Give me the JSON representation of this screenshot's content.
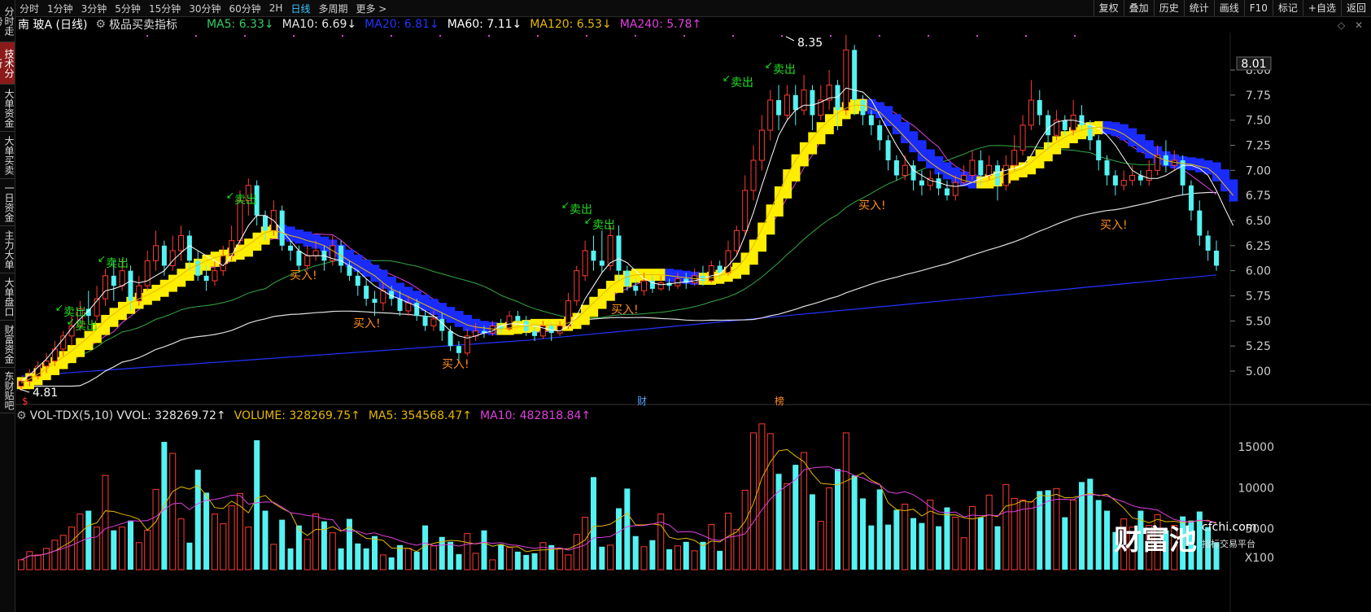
{
  "left_nav": [
    {
      "label": "分时走势",
      "active": false
    },
    {
      "label": "技术分析",
      "active": true
    },
    {
      "label": "大单资金",
      "active": false
    },
    {
      "label": "大单买卖",
      "active": false
    },
    {
      "label": "一日资金",
      "active": false
    },
    {
      "label": "主力大单",
      "active": false
    },
    {
      "label": "大单盘口",
      "active": false
    },
    {
      "label": "财富资金",
      "active": false
    },
    {
      "label": "东财贴吧",
      "active": false
    }
  ],
  "period_tabs": [
    "分时",
    "1分钟",
    "3分钟",
    "5分钟",
    "15分钟",
    "30分钟",
    "60分钟",
    "2H",
    "日线",
    "多周期",
    "更多 >"
  ],
  "active_period": "日线",
  "right_tools": [
    "复权",
    "叠加",
    "历史",
    "统计",
    "画线",
    "F10",
    "标记",
    "+自选",
    "返回"
  ],
  "legend": {
    "stock": "南 玻A (日线)",
    "indicator": "极品买卖指标",
    "ma": [
      {
        "text": "MA5: 6.33↓",
        "color": "#33cc66"
      },
      {
        "text": "MA10: 6.69↓",
        "color": "#e6e6e6"
      },
      {
        "text": "MA20: 6.81↓",
        "color": "#2233ff"
      },
      {
        "text": "MA60: 7.11↓",
        "color": "#ffffff"
      },
      {
        "text": "MA120: 6.53↓",
        "color": "#e6b800"
      },
      {
        "text": "MA240: 5.78↑",
        "color": "#e040e0"
      }
    ]
  },
  "vol_legend": {
    "title": "VOL-TDX(5,10)",
    "items": [
      {
        "text": "VVOL: 328269.72↑",
        "color": "#e6e6e6"
      },
      {
        "text": "VOLUME: 328269.75↑",
        "color": "#e6b800"
      },
      {
        "text": "MA5: 354568.47↑",
        "color": "#e6b800"
      },
      {
        "text": "MA10: 482818.84↑",
        "color": "#e040e0"
      }
    ]
  },
  "price_axis": {
    "labels": [
      "8.00",
      "7.75",
      "7.50",
      "7.25",
      "7.00",
      "6.75",
      "6.50",
      "6.25",
      "6.00",
      "5.75",
      "5.50",
      "5.25",
      "5.00"
    ],
    "current": "8.01"
  },
  "volume_axis": {
    "labels": [
      "15000",
      "10000",
      "5000"
    ],
    "unit": "X100"
  },
  "annotations": {
    "high": "8.35",
    "low": "4.81",
    "sell_label": "卖出",
    "buy_label": "买入!",
    "event_cai": "财",
    "event_bang": "榜",
    "event_s": "$"
  },
  "watermark": {
    "brand": "财富池",
    "site": "cfchi.com",
    "tagline": "指标交易平台"
  },
  "colors": {
    "up": "#ff3b30",
    "down": "#55f2f2",
    "ma5": "#ffffff",
    "ma10": "#e6b800",
    "ma20": "#e040e0",
    "ma60": "#33aa44",
    "ma120": "#dddddd",
    "ma240": "#2233ff",
    "band_up": "#ffee00",
    "band_down": "#1a2bff"
  },
  "chart_data": {
    "type": "candlestick",
    "ylim": [
      4.75,
      8.35
    ],
    "candles": [
      [
        4.85,
        4.9,
        4.8,
        4.92
      ],
      [
        4.9,
        4.95,
        4.85,
        5.02
      ],
      [
        4.95,
        5.05,
        4.92,
        5.1
      ],
      [
        5.05,
        5.1,
        4.98,
        5.18
      ],
      [
        5.1,
        5.22,
        5.05,
        5.3
      ],
      [
        5.22,
        5.35,
        5.15,
        5.4
      ],
      [
        5.35,
        5.45,
        5.25,
        5.55
      ],
      [
        5.45,
        5.62,
        5.4,
        5.7
      ],
      [
        5.62,
        5.55,
        5.48,
        5.8
      ],
      [
        5.55,
        5.72,
        5.5,
        5.85
      ],
      [
        5.72,
        5.95,
        5.65,
        6.02
      ],
      [
        5.95,
        5.85,
        5.7,
        6.1
      ],
      [
        5.85,
        6.0,
        5.8,
        6.12
      ],
      [
        6.0,
        5.7,
        5.6,
        6.05
      ],
      [
        5.7,
        5.85,
        5.65,
        5.95
      ],
      [
        5.85,
        6.1,
        5.8,
        6.2
      ],
      [
        6.1,
        6.25,
        6.0,
        6.4
      ],
      [
        6.25,
        6.05,
        5.95,
        6.3
      ],
      [
        6.05,
        6.2,
        6.0,
        6.35
      ],
      [
        6.2,
        6.35,
        6.1,
        6.45
      ],
      [
        6.35,
        6.1,
        6.0,
        6.4
      ],
      [
        6.1,
        5.95,
        5.9,
        6.2
      ],
      [
        5.95,
        5.9,
        5.8,
        6.05
      ],
      [
        5.9,
        6.0,
        5.85,
        6.1
      ],
      [
        6.0,
        6.15,
        5.95,
        6.25
      ],
      [
        6.15,
        6.3,
        6.1,
        6.45
      ],
      [
        6.3,
        6.7,
        6.25,
        6.8
      ],
      [
        6.7,
        6.85,
        6.55,
        6.92
      ],
      [
        6.85,
        6.55,
        6.45,
        6.9
      ],
      [
        6.55,
        6.4,
        6.3,
        6.6
      ],
      [
        6.4,
        6.6,
        6.35,
        6.7
      ],
      [
        6.6,
        6.25,
        6.2,
        6.65
      ],
      [
        6.25,
        6.2,
        6.1,
        6.3
      ],
      [
        6.2,
        6.05,
        6.0,
        6.25
      ],
      [
        6.05,
        6.15,
        6.0,
        6.25
      ],
      [
        6.15,
        6.2,
        6.1,
        6.3
      ],
      [
        6.2,
        6.1,
        6.0,
        6.25
      ],
      [
        6.1,
        6.25,
        6.05,
        6.35
      ],
      [
        6.25,
        6.05,
        5.98,
        6.3
      ],
      [
        6.05,
        5.95,
        5.9,
        6.1
      ],
      [
        5.95,
        5.85,
        5.75,
        6.0
      ],
      [
        5.85,
        5.72,
        5.65,
        5.92
      ],
      [
        5.72,
        5.68,
        5.55,
        5.8
      ],
      [
        5.68,
        5.8,
        5.6,
        5.88
      ],
      [
        5.8,
        5.72,
        5.65,
        5.85
      ],
      [
        5.72,
        5.6,
        5.55,
        5.8
      ],
      [
        5.6,
        5.68,
        5.55,
        5.75
      ],
      [
        5.68,
        5.55,
        5.5,
        5.72
      ],
      [
        5.55,
        5.45,
        5.4,
        5.6
      ],
      [
        5.45,
        5.52,
        5.4,
        5.6
      ],
      [
        5.52,
        5.4,
        5.3,
        5.58
      ],
      [
        5.4,
        5.25,
        5.2,
        5.45
      ],
      [
        5.25,
        5.18,
        5.1,
        5.3
      ],
      [
        5.18,
        5.35,
        5.15,
        5.42
      ],
      [
        5.35,
        5.4,
        5.3,
        5.48
      ],
      [
        5.4,
        5.38,
        5.33,
        5.45
      ],
      [
        5.38,
        5.45,
        5.35,
        5.5
      ],
      [
        5.45,
        5.42,
        5.38,
        5.52
      ],
      [
        5.42,
        5.55,
        5.4,
        5.6
      ],
      [
        5.55,
        5.5,
        5.45,
        5.6
      ],
      [
        5.5,
        5.4,
        5.35,
        5.55
      ],
      [
        5.4,
        5.35,
        5.3,
        5.45
      ],
      [
        5.35,
        5.45,
        5.32,
        5.5
      ],
      [
        5.45,
        5.38,
        5.3,
        5.48
      ],
      [
        5.38,
        5.45,
        5.35,
        5.5
      ],
      [
        5.45,
        5.7,
        5.42,
        5.78
      ],
      [
        5.7,
        6.0,
        5.65,
        6.05
      ],
      [
        5.95,
        6.2,
        5.9,
        6.3
      ],
      [
        6.2,
        6.1,
        6.0,
        6.35
      ],
      [
        6.1,
        6.05,
        5.98,
        6.4
      ],
      [
        6.05,
        6.35,
        6.0,
        6.45
      ],
      [
        6.35,
        6.0,
        5.9,
        6.45
      ],
      [
        6.0,
        5.85,
        5.8,
        6.05
      ],
      [
        5.85,
        5.8,
        5.75,
        5.92
      ],
      [
        5.8,
        5.9,
        5.75,
        5.98
      ],
      [
        5.9,
        5.82,
        5.78,
        5.95
      ],
      [
        5.82,
        5.88,
        5.8,
        5.95
      ],
      [
        5.88,
        5.85,
        5.8,
        5.92
      ],
      [
        5.85,
        5.92,
        5.82,
        5.98
      ],
      [
        5.92,
        5.88,
        5.82,
        5.98
      ],
      [
        5.88,
        5.95,
        5.85,
        6.02
      ],
      [
        5.95,
        5.9,
        5.85,
        6.05
      ],
      [
        5.9,
        6.05,
        5.88,
        6.1
      ],
      [
        6.05,
        5.98,
        5.92,
        6.1
      ],
      [
        5.98,
        6.2,
        5.95,
        6.3
      ],
      [
        6.2,
        6.4,
        6.15,
        6.45
      ],
      [
        6.4,
        6.8,
        6.35,
        6.95
      ],
      [
        6.8,
        7.1,
        6.7,
        7.25
      ],
      [
        7.1,
        7.4,
        7.0,
        7.55
      ],
      [
        7.4,
        7.7,
        7.3,
        7.8
      ],
      [
        7.7,
        7.55,
        7.4,
        7.85
      ],
      [
        7.55,
        7.75,
        7.5,
        7.85
      ],
      [
        7.75,
        7.6,
        7.45,
        7.85
      ],
      [
        7.6,
        7.8,
        7.55,
        7.95
      ],
      [
        7.8,
        7.55,
        7.4,
        7.85
      ],
      [
        7.55,
        7.7,
        7.5,
        7.85
      ],
      [
        7.7,
        7.85,
        7.6,
        8.0
      ],
      [
        7.85,
        7.6,
        7.4,
        7.9
      ],
      [
        7.6,
        8.2,
        7.55,
        8.35
      ],
      [
        8.2,
        7.7,
        7.55,
        8.25
      ],
      [
        7.7,
        7.55,
        7.45,
        7.75
      ],
      [
        7.55,
        7.45,
        7.35,
        7.6
      ],
      [
        7.45,
        7.3,
        7.2,
        7.5
      ],
      [
        7.3,
        7.1,
        7.0,
        7.35
      ],
      [
        7.1,
        6.95,
        6.9,
        7.15
      ],
      [
        6.95,
        7.05,
        6.9,
        7.15
      ],
      [
        7.05,
        6.9,
        6.8,
        7.1
      ],
      [
        6.9,
        6.85,
        6.75,
        7.0
      ],
      [
        6.85,
        6.92,
        6.8,
        7.0
      ],
      [
        6.92,
        6.82,
        6.75,
        6.98
      ],
      [
        6.82,
        6.75,
        6.7,
        6.9
      ],
      [
        6.75,
        6.88,
        6.7,
        6.95
      ],
      [
        6.88,
        6.95,
        6.85,
        7.05
      ],
      [
        6.95,
        7.1,
        6.9,
        7.2
      ],
      [
        7.1,
        6.95,
        6.85,
        7.2
      ],
      [
        6.95,
        7.05,
        6.9,
        7.15
      ],
      [
        7.05,
        6.85,
        6.7,
        7.1
      ],
      [
        6.85,
        7.05,
        6.8,
        7.15
      ],
      [
        7.05,
        7.2,
        7.0,
        7.35
      ],
      [
        7.2,
        7.45,
        7.15,
        7.55
      ],
      [
        7.45,
        7.7,
        7.4,
        7.9
      ],
      [
        7.7,
        7.55,
        7.45,
        7.8
      ],
      [
        7.55,
        7.35,
        7.2,
        7.6
      ],
      [
        7.35,
        7.5,
        7.3,
        7.6
      ],
      [
        7.5,
        7.4,
        7.35,
        7.55
      ],
      [
        7.4,
        7.55,
        7.35,
        7.7
      ],
      [
        7.55,
        7.45,
        7.4,
        7.65
      ],
      [
        7.45,
        7.3,
        7.2,
        7.5
      ],
      [
        7.3,
        7.1,
        7.0,
        7.35
      ],
      [
        7.1,
        6.95,
        6.85,
        7.15
      ],
      [
        6.95,
        6.85,
        6.75,
        7.0
      ],
      [
        6.85,
        6.9,
        6.8,
        7.0
      ],
      [
        6.9,
        6.95,
        6.85,
        7.05
      ],
      [
        6.95,
        6.9,
        6.85,
        7.0
      ],
      [
        6.9,
        7.0,
        6.85,
        7.1
      ],
      [
        7.0,
        7.15,
        6.95,
        7.25
      ],
      [
        7.15,
        7.05,
        6.98,
        7.3
      ],
      [
        7.05,
        7.1,
        7.0,
        7.2
      ],
      [
        7.1,
        6.85,
        6.75,
        7.15
      ],
      [
        6.85,
        6.6,
        6.5,
        6.9
      ],
      [
        6.6,
        6.35,
        6.25,
        6.7
      ],
      [
        6.35,
        6.2,
        6.1,
        6.4
      ],
      [
        6.2,
        6.05,
        6.0,
        6.3
      ]
    ],
    "volumes": [
      1200,
      2200,
      1800,
      2600,
      3600,
      4200,
      5200,
      6800,
      7200,
      5200,
      11500,
      4800,
      5200,
      6000,
      3300,
      4800,
      9800,
      15600,
      14200,
      6200,
      3300,
      12200,
      9400,
      6800,
      5600,
      7800,
      9300,
      5200,
      15800,
      7200,
      3100,
      6100,
      2600,
      5400,
      3700,
      6800,
      5900,
      4500,
      2600,
      6200,
      3200,
      2600,
      4100,
      1800,
      1500,
      3000,
      2600,
      2200,
      5400,
      2900,
      4000,
      3400,
      1900,
      4400,
      2000,
      4800,
      1200,
      3100,
      2700,
      2200,
      1800,
      2000,
      3300,
      3000,
      2600,
      1800,
      4300,
      6400,
      11300,
      2800,
      3000,
      7500,
      9900,
      4100,
      2800,
      3600,
      6800,
      2500,
      2900,
      3400,
      2300,
      3400,
      5500,
      2300,
      6900,
      4900,
      9700,
      16700,
      17800,
      16600,
      11700,
      10500,
      12800,
      14300,
      9200,
      5900,
      10000,
      12300,
      16700,
      11500,
      8700,
      5400,
      9800,
      5500,
      7300,
      8000,
      6300,
      5700,
      8500,
      5300,
      7600,
      6400,
      3900,
      7700,
      6400,
      9100,
      5300,
      10400,
      8700,
      8500,
      8300,
      9600,
      9700,
      9900,
      6400,
      8500,
      10700,
      11100,
      8500,
      7200,
      4600,
      6200,
      5200,
      7200,
      5400,
      6700,
      4800,
      5400,
      6500,
      6000,
      7100,
      5200,
      3300
    ],
    "ma_series": {
      "MA5": [
        4.9,
        4.96,
        5.04,
        5.12,
        5.22,
        5.32,
        5.43,
        5.52,
        5.6,
        5.7,
        5.8,
        5.82,
        5.85,
        5.9,
        5.88,
        5.9,
        5.95,
        6.0,
        6.1,
        6.18,
        6.25,
        6.2,
        6.15,
        6.1,
        6.05,
        6.15,
        6.3,
        6.45,
        6.55,
        6.55,
        6.5,
        6.4,
        6.3,
        6.2,
        6.15,
        6.15,
        6.15,
        6.12,
        6.1,
        6.05,
        6.0,
        5.92,
        5.85,
        5.8,
        5.75,
        5.72,
        5.68,
        5.65,
        5.6,
        5.55,
        5.48,
        5.4,
        5.35,
        5.33,
        5.35,
        5.38,
        5.4,
        5.45,
        5.47,
        5.47,
        5.46,
        5.45,
        5.43,
        5.41,
        5.4,
        5.45,
        5.55,
        5.72,
        5.85,
        5.98,
        6.08,
        6.12,
        6.08,
        6.0,
        5.92,
        5.88,
        5.86,
        5.87,
        5.88,
        5.89,
        5.9,
        5.92,
        5.95,
        5.97,
        6.05,
        6.15,
        6.35,
        6.58,
        6.85,
        7.1,
        7.35,
        7.5,
        7.6,
        7.65,
        7.65,
        7.68,
        7.72,
        7.73,
        7.82,
        7.8,
        7.78,
        7.7,
        7.55,
        7.4,
        7.25,
        7.12,
        7.0,
        6.95,
        6.9,
        6.88,
        6.85,
        6.84,
        6.85,
        6.88,
        6.92,
        6.95,
        6.98,
        7.0,
        7.02,
        7.05,
        7.15,
        7.3,
        7.42,
        7.48,
        7.5,
        7.5,
        7.48,
        7.45,
        7.42,
        7.35,
        7.25,
        7.12,
        7.0,
        6.95,
        6.92,
        6.92,
        6.95,
        7.0,
        7.05,
        7.05,
        7.02,
        6.95,
        6.8,
        6.62,
        6.45
      ],
      "MA10": [
        4.88,
        4.92,
        4.97,
        5.02,
        5.08,
        5.14,
        5.2,
        5.27,
        5.34,
        5.42,
        5.5,
        5.57,
        5.63,
        5.68,
        5.72,
        5.76,
        5.8,
        5.85,
        5.9,
        5.96,
        6.02,
        6.06,
        6.1,
        6.13,
        6.15,
        6.17,
        6.2,
        6.26,
        6.32,
        6.38,
        6.4,
        6.38,
        6.35,
        6.33,
        6.3,
        6.28,
        6.25,
        6.2,
        6.15,
        6.1,
        6.05,
        6.0,
        5.95,
        5.88,
        5.82,
        5.78,
        5.74,
        5.7,
        5.66,
        5.62,
        5.58,
        5.54,
        5.5,
        5.46,
        5.44,
        5.43,
        5.42,
        5.42,
        5.43,
        5.44,
        5.45,
        5.46,
        5.46,
        5.46,
        5.46,
        5.48,
        5.52,
        5.6,
        5.68,
        5.76,
        5.84,
        5.9,
        5.94,
        5.96,
        5.96,
        5.96,
        5.96,
        5.95,
        5.94,
        5.93,
        5.92,
        5.92,
        5.93,
        5.95,
        5.98,
        6.02,
        6.12,
        6.25,
        6.42,
        6.6,
        6.78,
        6.95,
        7.1,
        7.22,
        7.32,
        7.42,
        7.5,
        7.57,
        7.62,
        7.65,
        7.65,
        7.62,
        7.58,
        7.5,
        7.42,
        7.33,
        7.24,
        7.15,
        7.08,
        7.02,
        6.97,
        6.93,
        6.9,
        6.88,
        6.88,
        6.9,
        6.93,
        6.96,
        6.99,
        7.02,
        7.08,
        7.15,
        7.22,
        7.28,
        7.33,
        7.37,
        7.4,
        7.42,
        7.43,
        7.42,
        7.4,
        7.36,
        7.3,
        7.24,
        7.18,
        7.13,
        7.1,
        7.08,
        7.07,
        7.06,
        7.04,
        7.02,
        6.95,
        6.85,
        6.75
      ]
    }
  }
}
